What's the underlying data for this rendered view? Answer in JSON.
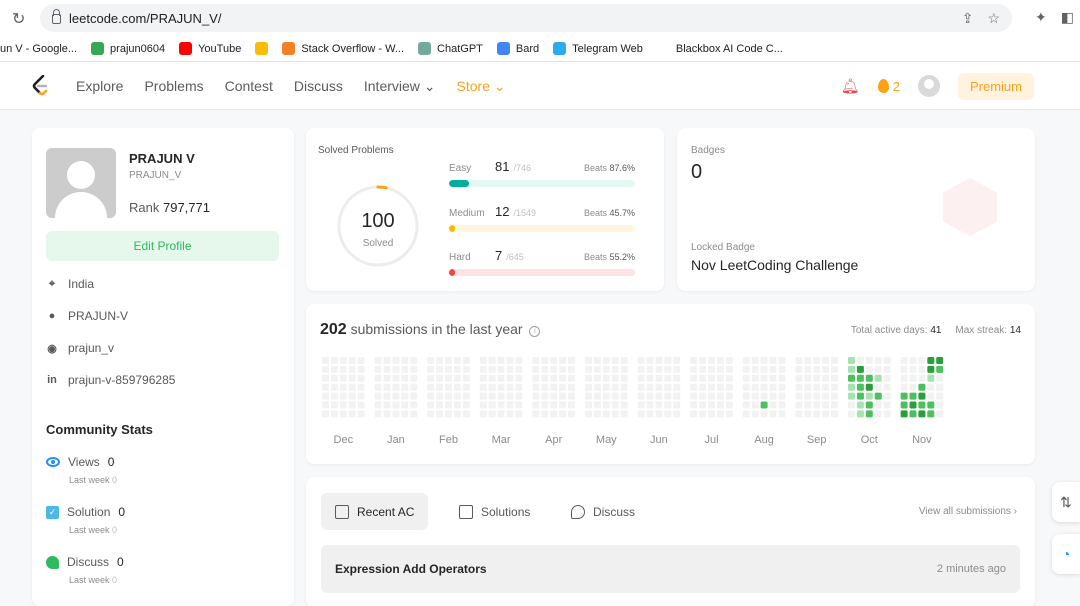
{
  "browser": {
    "url": "leetcode.com/PRAJUN_V/",
    "bookmarks": [
      {
        "label": "un V - Google...",
        "color": "#ffffff"
      },
      {
        "label": "prajun0604",
        "color": "#34a853"
      },
      {
        "label": "YouTube",
        "color": "#ff0000"
      },
      {
        "label": "",
        "color": "#fbbc04"
      },
      {
        "label": "Stack Overflow - W...",
        "color": "#f48024"
      },
      {
        "label": "ChatGPT",
        "color": "#74aa9c"
      },
      {
        "label": "Bard",
        "color": "#4285f4"
      },
      {
        "label": "Telegram Web",
        "color": "#2aabee"
      },
      {
        "label": "Blackbox AI Code C...",
        "color": "#ffffff"
      }
    ]
  },
  "nav": {
    "links": [
      "Explore",
      "Problems",
      "Contest",
      "Discuss",
      "Interview ⌄",
      "Store ⌄"
    ],
    "streak_count": "2",
    "premium_label": "Premium"
  },
  "profile": {
    "name": "PRAJUN V",
    "username": "PRAJUN_V",
    "rank_label": "Rank",
    "rank_value": "797,771",
    "edit_label": "Edit Profile",
    "location": "India",
    "github": "PRAJUN-V",
    "website": "prajun_v",
    "linkedin": "prajun-v-859796285"
  },
  "community": {
    "title": "Community Stats",
    "items": [
      {
        "label": "Views",
        "value": "0",
        "last_week_label": "Last week",
        "last_week_value": "0"
      },
      {
        "label": "Solution",
        "value": "0",
        "last_week_label": "Last week",
        "last_week_value": "0"
      },
      {
        "label": "Discuss",
        "value": "0",
        "last_week_label": "Last week",
        "last_week_value": "0"
      }
    ]
  },
  "solved": {
    "title": "Solved Problems",
    "total": "100",
    "total_label": "Solved",
    "difficulties": [
      {
        "label": "Easy",
        "count": "81",
        "total": "/746",
        "beats_label": "Beats",
        "beats": "87.6%",
        "fraction": 0.1086,
        "color": "#00af9b",
        "track": "#e3f7f3"
      },
      {
        "label": "Medium",
        "count": "12",
        "total": "/1549",
        "beats_label": "Beats",
        "beats": "45.7%",
        "fraction": 0.0077,
        "color": "#ffb800",
        "track": "#fff6dd"
      },
      {
        "label": "Hard",
        "count": "7",
        "total": "/645",
        "beats_label": "Beats",
        "beats": "55.2%",
        "fraction": 0.0109,
        "color": "#ef4743",
        "track": "#fde3e3"
      }
    ]
  },
  "badges": {
    "title": "Badges",
    "count": "0",
    "locked_label": "Locked Badge",
    "locked_name": "Nov LeetCoding Challenge"
  },
  "calendar": {
    "count": "202",
    "label": "submissions in the last year",
    "total_active_label": "Total active days:",
    "total_active": "41",
    "max_streak_label": "Max streak:",
    "max_streak": "14",
    "months": [
      "Dec",
      "Jan",
      "Feb",
      "Mar",
      "Apr",
      "May",
      "Jun",
      "Jul",
      "Aug",
      "Sep",
      "Oct",
      "Nov"
    ],
    "colors": {
      "empty": "#f2f2f2",
      "l1": "#a6e3b0",
      "l2": "#4cc05f",
      "l3": "#2a9d3c",
      "l4": "#1a7a2a"
    }
  },
  "activity": {
    "tabs": [
      "Recent AC",
      "Solutions",
      "Discuss"
    ],
    "view_all": "View all submissions ›",
    "recent": [
      {
        "title": "Expression Add Operators",
        "ago": "2 minutes ago"
      }
    ]
  }
}
